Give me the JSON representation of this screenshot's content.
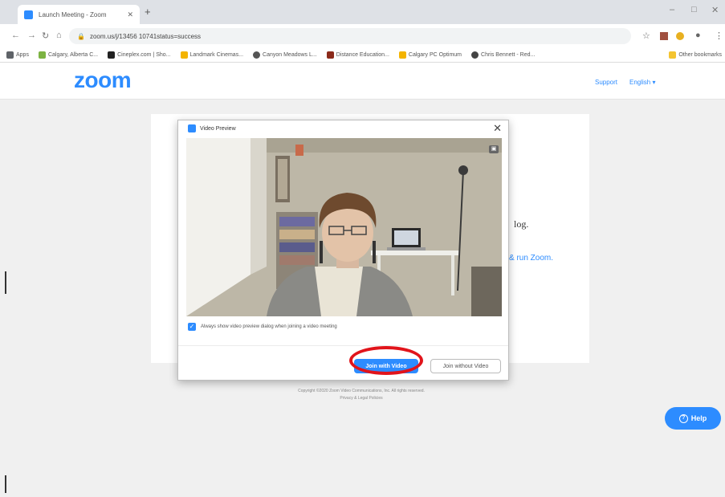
{
  "browser": {
    "tab_title": "Launch Meeting - Zoom",
    "tab_close": "✕",
    "new_tab": "+",
    "url": "zoom.us/j/13456 10741status=success",
    "window_controls": [
      "–",
      "□",
      "✕"
    ],
    "bookmarks": [
      {
        "label": "Apps",
        "color": "#5f6368"
      },
      {
        "label": "Calgary, Alberta C...",
        "color": "#7cb342"
      },
      {
        "label": "Cineplex.com | Sho...",
        "color": "#222222"
      },
      {
        "label": "Landmark Cinemas...",
        "color": "#f4b400"
      },
      {
        "label": "Canyon Meadows L...",
        "color": "#555555"
      },
      {
        "label": "Distance Education...",
        "color": "#8b2a1a"
      },
      {
        "label": "Calgary PC Optimum",
        "color": "#f4b400"
      },
      {
        "label": "Chris Bennett - Red...",
        "color": "#444444"
      }
    ],
    "other_bookmarks": "Other bookmarks"
  },
  "zoom": {
    "logo": "zoom",
    "header_links": [
      "Support",
      "English ▾"
    ],
    "page_text_dialog": "log.",
    "page_text_run": "& run Zoom.",
    "copyright_lines": [
      "Copyright ©2020 Zoom Video Communications, Inc. All rights reserved.",
      "Privacy & Legal Policies"
    ],
    "help_label": "Help",
    "help_icon": "?"
  },
  "dialog": {
    "title": "Video Preview",
    "close": "✕",
    "camera_icon": "▣",
    "checkbox_mark": "✓",
    "preference_text": "Always show video preview dialog when joining a video meeting",
    "join_with_video": "Join with Video",
    "join_without_video": "Join without Video"
  },
  "colors": {
    "zoom_blue": "#2d8cff",
    "highlight_red": "#e1141b"
  }
}
